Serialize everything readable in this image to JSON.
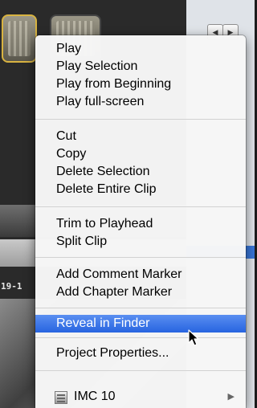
{
  "background": {
    "timecode_label": "19-1"
  },
  "menu": {
    "group_play": [
      "Play",
      "Play Selection",
      "Play from Beginning",
      "Play full-screen"
    ],
    "group_edit": [
      "Cut",
      "Copy",
      "Delete Selection",
      "Delete Entire Clip"
    ],
    "group_clip": [
      "Trim to Playhead",
      "Split Clip"
    ],
    "group_markers": [
      "Add Comment Marker",
      "Add Chapter Marker"
    ],
    "reveal": "Reveal in Finder",
    "project_properties": "Project Properties...",
    "event_item": "IMC 10"
  },
  "colors": {
    "highlight": "#3875d7",
    "menu_bg": "#f6f6f6"
  },
  "icons": {
    "event_icon": "film-event-icon",
    "submenu": "chevron-right-icon",
    "cursor": "arrow-cursor-icon"
  }
}
